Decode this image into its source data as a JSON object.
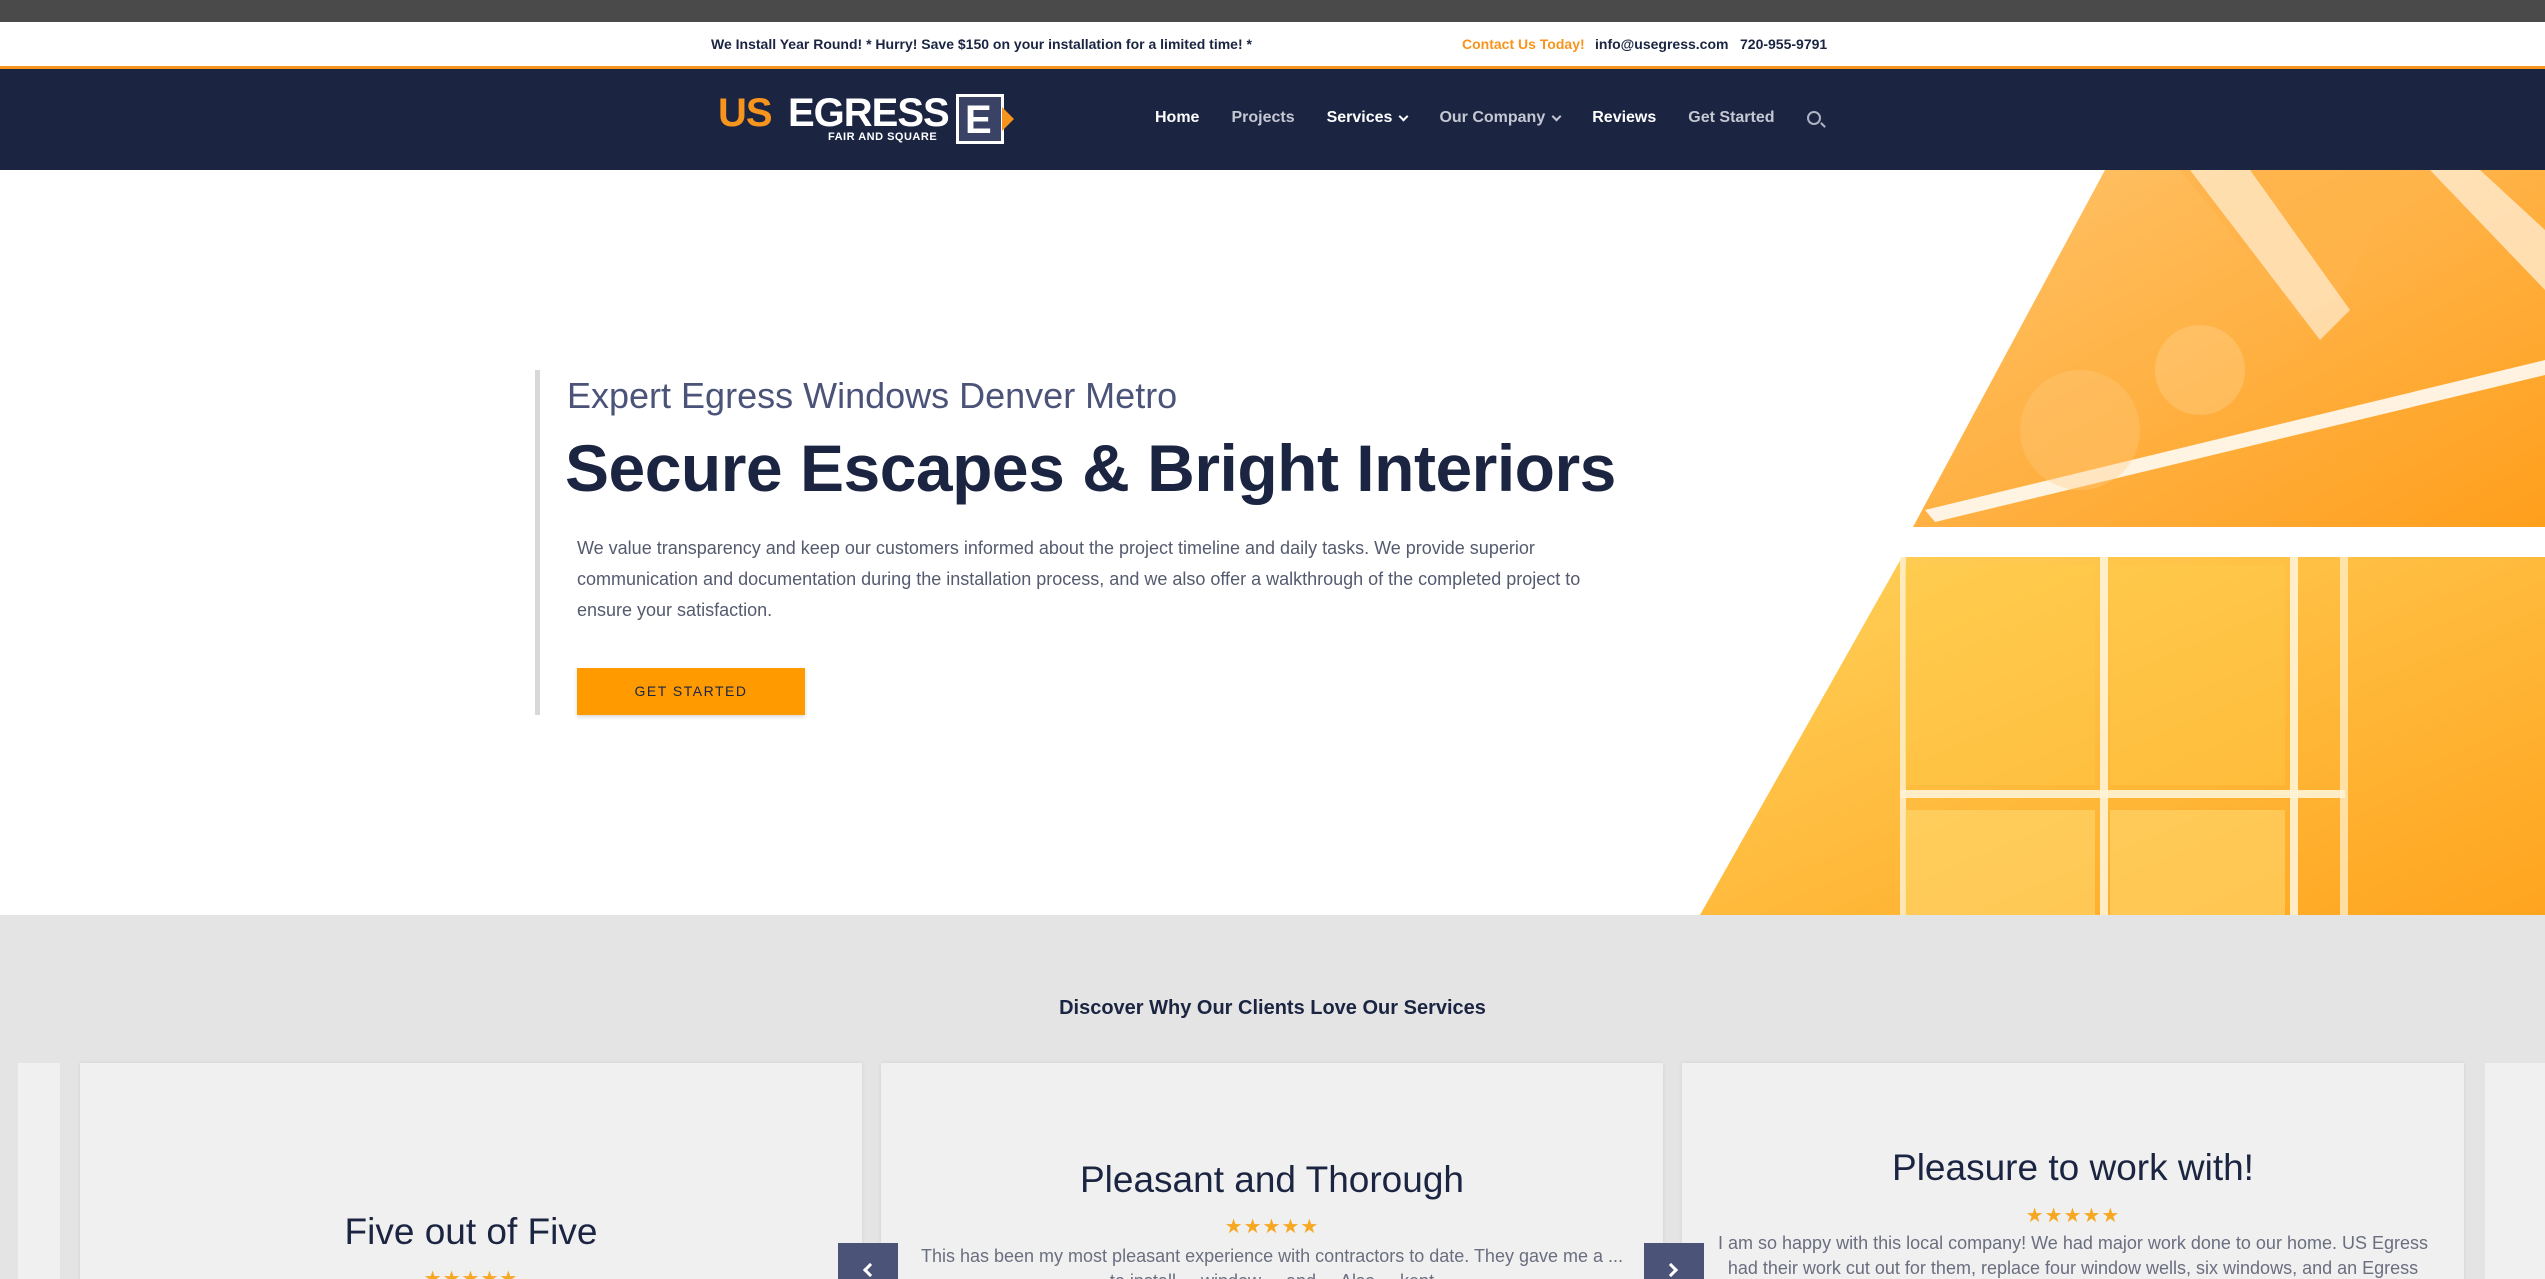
{
  "topbar": {
    "promo": "We Install Year Round! * Hurry! Save $150 on your installation for a limited time! *",
    "contact_cta": "Contact Us Today!",
    "email": "info@usegress.com",
    "phone": "720-955-9791"
  },
  "logo": {
    "us": "US",
    "egress": "EGRESS",
    "tagline": "FAIR AND SQUARE",
    "mark": "E"
  },
  "nav": {
    "items": [
      {
        "label": "Home"
      },
      {
        "label": "Projects"
      },
      {
        "label": "Services"
      },
      {
        "label": "Our Company"
      },
      {
        "label": "Reviews"
      },
      {
        "label": "Get Started"
      }
    ]
  },
  "hero": {
    "eyebrow": "Expert Egress Windows Denver Metro",
    "headline": "Secure Escapes & Bright Interiors",
    "body": "We value transparency and keep our customers informed about the project timeline and daily tasks. We provide superior communication and documentation during the installation process, and we also offer a walkthrough of the completed project to ensure your satisfaction.",
    "cta": "GET STARTED"
  },
  "reviews": {
    "heading": "Discover Why Our Clients Love Our Services",
    "cards": [
      {
        "title": "Five out of Five",
        "stars": "★★★★★",
        "text": ""
      },
      {
        "title": "Pleasant and Thorough",
        "stars": "★★★★★",
        "text": "This has been my most pleasant experience with contractors to date. They gave me a ... to install ... window ... and ... Also ... kept"
      },
      {
        "title": "Pleasure to work with!",
        "stars": "★★★★★",
        "text": "I am so happy with this local company! We had major work done to our home. US Egress had their work cut out for them, replace four window wells, six windows, and an Egress"
      }
    ]
  },
  "colors": {
    "navy": "#1b2542",
    "accent": "#f7941d",
    "button": "#ff9a00",
    "reviews_bg": "#e4e4e4"
  },
  "icons": [
    "search-icon",
    "chevron-down-icon",
    "chevron-left-icon",
    "chevron-right-icon",
    "star-icon"
  ]
}
